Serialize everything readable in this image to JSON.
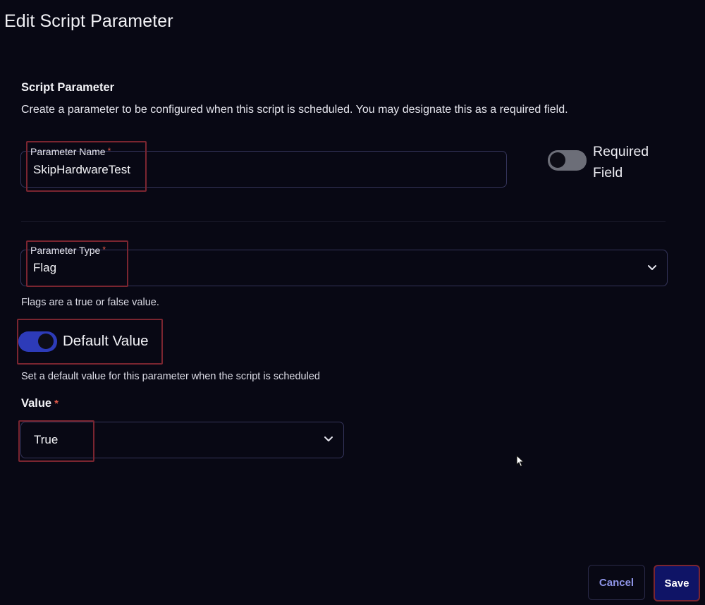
{
  "dialog": {
    "title": "Edit Script Parameter"
  },
  "section": {
    "title": "Script Parameter",
    "description": "Create a parameter to be configured when this script is scheduled. You may designate this as a required field."
  },
  "parameter_name": {
    "label": "Parameter Name",
    "required_marker": "*",
    "value": "SkipHardwareTest"
  },
  "required_field": {
    "label_line1": "Required",
    "label_line2": "Field",
    "enabled": false
  },
  "parameter_type": {
    "label": "Parameter Type",
    "required_marker": "*",
    "selected": "Flag",
    "helper": "Flags are a true or false value."
  },
  "default_value": {
    "label": "Default Value",
    "enabled": true,
    "helper": "Set a default value for this parameter when the script is scheduled"
  },
  "value_field": {
    "label": "Value",
    "required_marker": "*",
    "selected": "True"
  },
  "buttons": {
    "cancel": "Cancel",
    "save": "Save"
  },
  "colors": {
    "background": "#080814",
    "accent": "#2d3bb8",
    "save_button": "#0f1466",
    "cancel_text": "#8f95e8",
    "required_star": "#e05a4a",
    "highlight_box": "#7a2530"
  },
  "icons": {
    "dropdown": "chevron-down-icon",
    "pointer": "mouse-cursor-icon"
  }
}
